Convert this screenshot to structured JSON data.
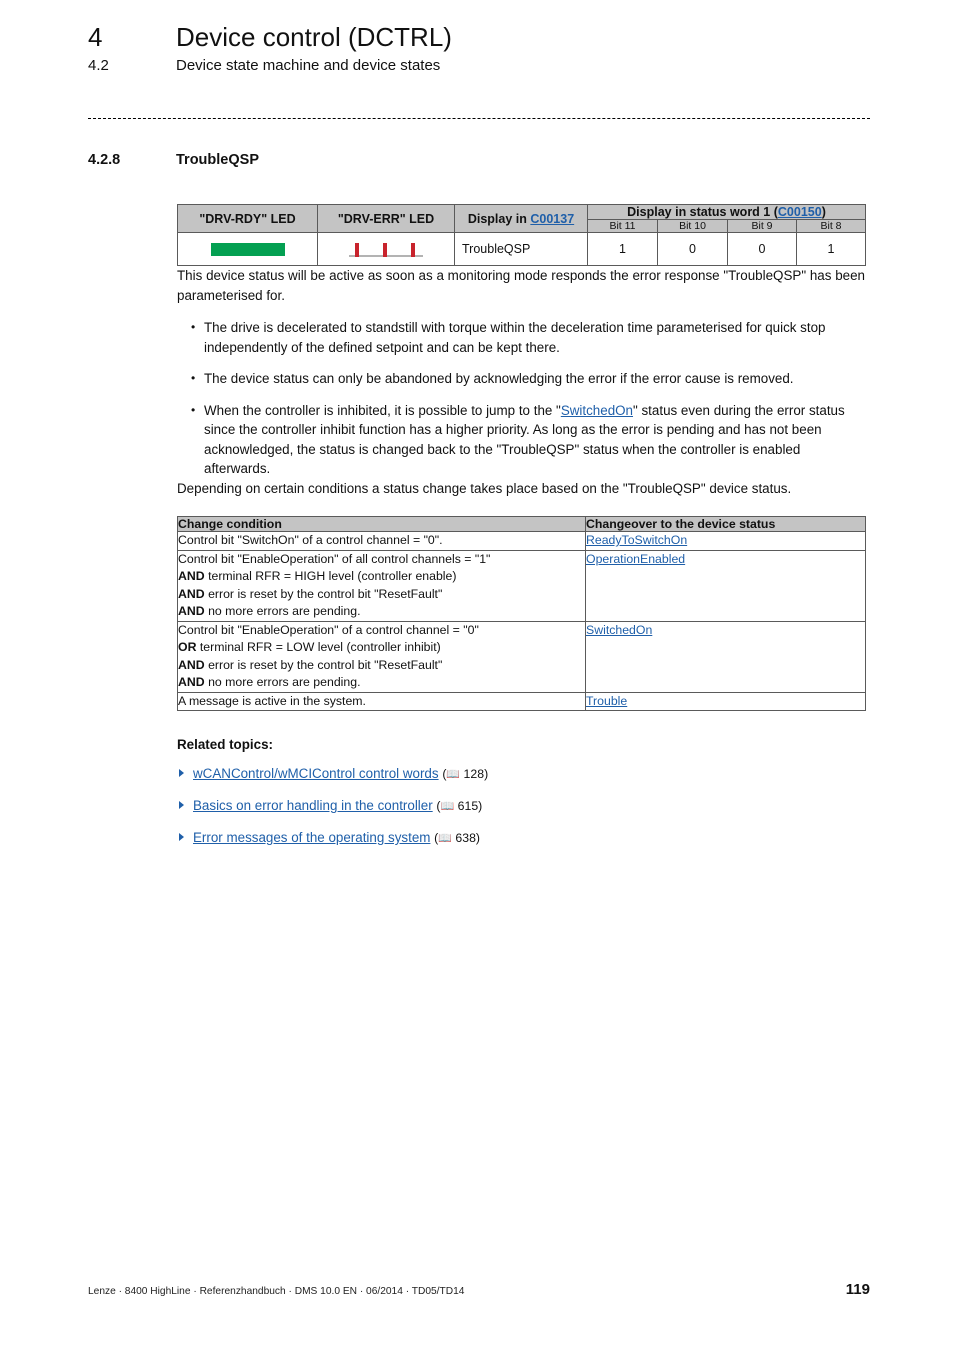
{
  "header": {
    "chapter_number": "4",
    "chapter_title": "Device control (DCTRL)",
    "section_number": "4.2",
    "section_title": "Device state machine and device states"
  },
  "section": {
    "number": "4.2.8",
    "title": "TroubleQSP"
  },
  "status_table": {
    "headers": {
      "drv_rdy": "\"DRV-RDY\" LED",
      "drv_err": "\"DRV-ERR\" LED",
      "display_in_prefix": "Display in ",
      "display_in_code": "C00137",
      "status_word_prefix": "Display in status word 1 (",
      "status_word_code": "C00150",
      "status_word_suffix": ")"
    },
    "bit_headers": [
      "Bit 11",
      "Bit 10",
      "Bit 9",
      "Bit 8"
    ],
    "row": {
      "drv_rdy_led": "steady-green",
      "drv_err_led": "blinking-red",
      "display_value": "TroubleQSP",
      "bits": [
        "1",
        "0",
        "0",
        "1"
      ]
    }
  },
  "body": {
    "intro": "This device status will be active as soon as a monitoring mode responds the error response \"TroubleQSP\" has been parameterised for.",
    "bullet1": "The drive is decelerated to standstill with torque within the deceleration time parameterised for quick stop independently of the defined setpoint and can be kept there.",
    "bullet2": "The device status can only be abandoned by acknowledging the error if the error cause is removed.",
    "bullet3_part1": "When the controller is inhibited, it is possible to jump to the \"",
    "bullet3_link": "SwitchedOn",
    "bullet3_part2": "\" status even during the error status since the controller inhibit function has a higher priority. As long as the error is pending and has not been acknowledged, the status is changed back to the \"TroubleQSP\" status when the controller is enabled afterwards.",
    "depending": "Depending on certain conditions a status change takes place based on the \"TroubleQSP\" device status."
  },
  "condition_table": {
    "headers": [
      "Change condition",
      "Changeover to the device status"
    ],
    "rows": [
      {
        "condition_lines": [
          "Control bit \"SwitchOn\" of a control channel = \"0\"."
        ],
        "condition_bold_prefixes": [
          ""
        ],
        "status": "ReadyToSwitchOn"
      },
      {
        "condition_lines": [
          "Control bit \"EnableOperation\" of all control channels = \"1\"",
          "terminal RFR = HIGH level (controller enable)",
          "error is reset by the control bit \"ResetFault\"",
          "no more errors are pending."
        ],
        "condition_bold_prefixes": [
          "",
          "AND ",
          "AND ",
          "AND "
        ],
        "status": "OperationEnabled"
      },
      {
        "condition_lines": [
          "Control bit \"EnableOperation\" of a control channel = \"0\"",
          "terminal RFR = LOW level (controller inhibit)",
          "error is reset by the control bit \"ResetFault\"",
          "no more errors are pending."
        ],
        "condition_bold_prefixes": [
          "",
          "OR ",
          "AND ",
          "AND "
        ],
        "status": "SwitchedOn"
      },
      {
        "condition_lines": [
          "A message is active in the system."
        ],
        "condition_bold_prefixes": [
          ""
        ],
        "status": "Trouble"
      }
    ]
  },
  "related_topics": {
    "title": "Related topics:",
    "items": [
      {
        "label": "wCANControl/wMCIControl control words",
        "page": "128"
      },
      {
        "label": "Basics on error handling in the controller",
        "page": "615"
      },
      {
        "label": "Error messages of the operating system",
        "page": "638"
      }
    ]
  },
  "footer": {
    "text": "Lenze · 8400 HighLine · Referenzhandbuch · DMS 10.0 EN · 06/2014 · TD05/TD14",
    "page_number": "119"
  },
  "colors": {
    "led_green": "#04a052",
    "led_red": "#c8232c",
    "link_blue": "#1f5fa9",
    "table_header_gray": "#c4c4c4"
  }
}
